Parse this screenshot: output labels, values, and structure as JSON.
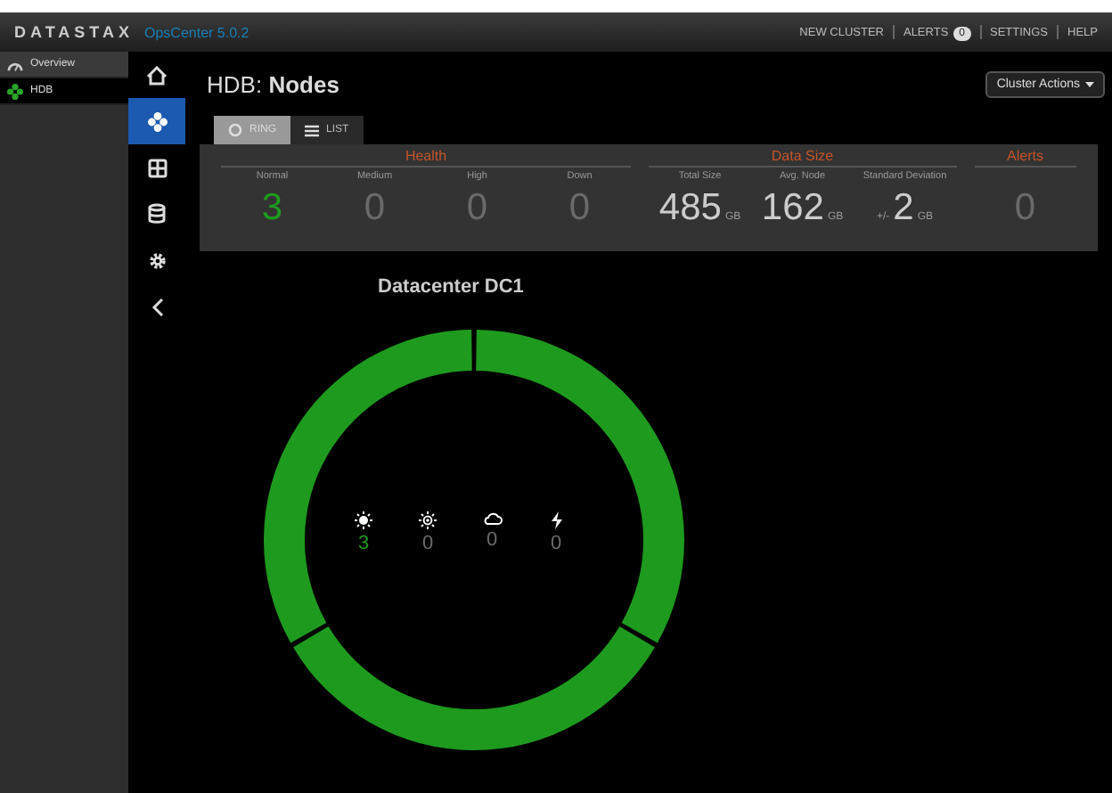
{
  "header": {
    "logo": "DATASTAX",
    "product": "OpsCenter 5.0.2",
    "links": [
      {
        "label": "NEW CLUSTER"
      },
      {
        "label": "ALERTS",
        "badge": "0"
      },
      {
        "label": "SETTINGS"
      },
      {
        "label": "HELP"
      }
    ]
  },
  "sidebar": {
    "items": [
      {
        "label": "Overview",
        "kind": "gauge",
        "selected": false
      },
      {
        "label": "HDB",
        "kind": "cluster",
        "selected": true
      }
    ]
  },
  "rail": [
    {
      "kind": "home",
      "selected": false
    },
    {
      "kind": "nodes",
      "selected": true
    },
    {
      "kind": "dashboard",
      "selected": false
    },
    {
      "kind": "database",
      "selected": false
    },
    {
      "kind": "gear",
      "selected": false
    },
    {
      "kind": "back",
      "selected": false
    }
  ],
  "page": {
    "title_prefix": "HDB:",
    "title": "Nodes",
    "actions": "Cluster Actions"
  },
  "view_tabs": [
    {
      "label": "RING",
      "kind": "ring",
      "selected": true
    },
    {
      "label": "LIST",
      "kind": "list",
      "selected": false
    }
  ],
  "stats": [
    {
      "title": "Health",
      "items": [
        {
          "label": "Normal",
          "value": "3",
          "color": "#1e9a1e"
        },
        {
          "label": "Medium",
          "value": "0",
          "color": "#6a6a6a"
        },
        {
          "label": "High",
          "value": "0",
          "color": "#6a6a6a"
        },
        {
          "label": "Down",
          "value": "0",
          "color": "#6a6a6a"
        }
      ]
    },
    {
      "title": "Data Size",
      "items": [
        {
          "label": "Total Size",
          "value": "485",
          "unit": "GB"
        },
        {
          "label": "Avg. Node",
          "value": "162",
          "unit": "GB"
        },
        {
          "label": "Standard Deviation",
          "prefix": "+/-",
          "value": "2",
          "unit": "GB"
        }
      ]
    },
    {
      "title": "Alerts",
      "items": [
        {
          "value": "0",
          "color": "#6a6a6a"
        }
      ]
    }
  ],
  "datacenter": {
    "title": "Datacenter DC1",
    "segments": [
      {
        "color": "#1e9a1e"
      },
      {
        "color": "#1e9a1e"
      },
      {
        "color": "#1e9a1e"
      }
    ],
    "counts": [
      {
        "kind": "sun",
        "value": "3",
        "color": "#1e9a1e"
      },
      {
        "kind": "partly",
        "value": "0",
        "color": "#6a6a6a"
      },
      {
        "kind": "cloud",
        "value": "0",
        "color": "#6a6a6a"
      },
      {
        "kind": "bolt",
        "value": "0",
        "color": "#6a6a6a"
      }
    ]
  }
}
